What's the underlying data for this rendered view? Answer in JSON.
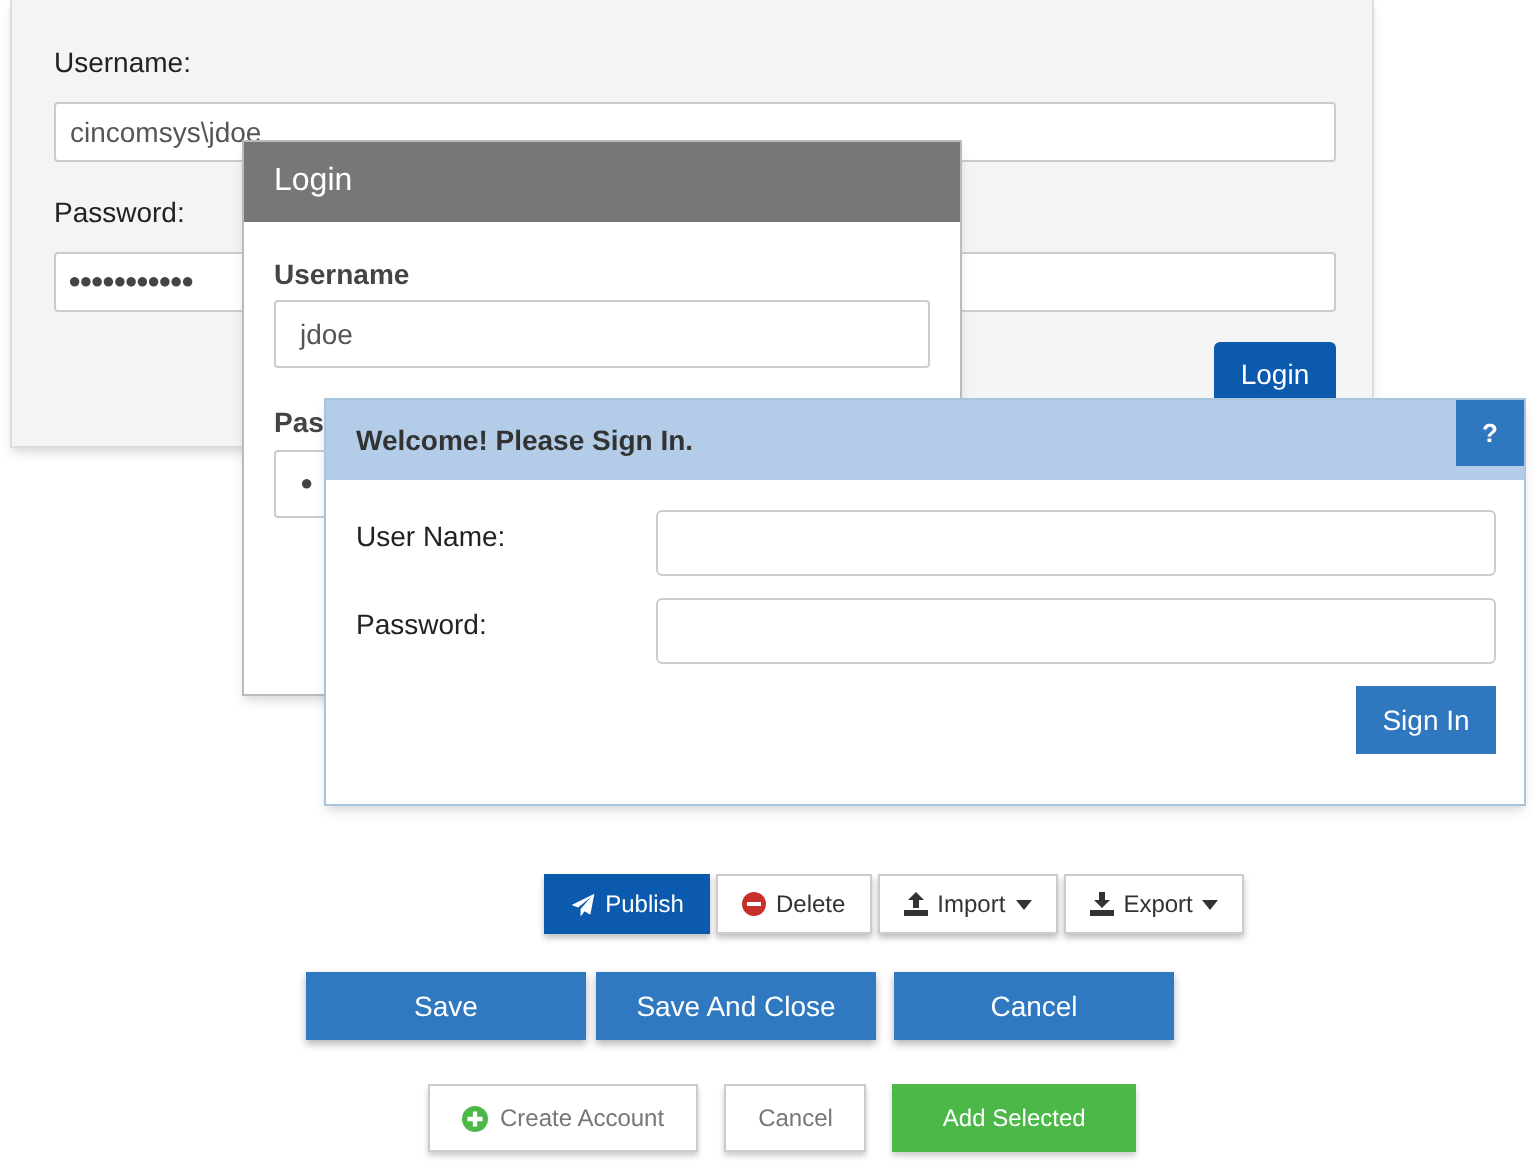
{
  "background_form": {
    "username_label": "Username:",
    "username_value": "cincomsys\\jdoe",
    "password_label": "Password:",
    "password_value": "●●●●●●●●●●●",
    "login_button": "Login"
  },
  "login_dialog": {
    "title": "Login",
    "username_label": "Username",
    "username_value": "jdoe",
    "password_label": "Pas",
    "password_value": "●"
  },
  "signin_dialog": {
    "title": "Welcome! Please Sign In.",
    "help_button": "?",
    "fields": [
      {
        "label": "User Name:"
      },
      {
        "label": "Password:"
      }
    ],
    "sign_in_button": "Sign In"
  },
  "toolbar": [
    {
      "label": "Publish",
      "kind": "primary",
      "dropdown": false
    },
    {
      "label": "Delete",
      "kind": "default",
      "dropdown": false
    },
    {
      "label": "Import",
      "kind": "default",
      "dropdown": true
    },
    {
      "label": "Export",
      "kind": "default",
      "dropdown": true
    }
  ],
  "action_buttons": [
    {
      "label": "Save"
    },
    {
      "label": "Save And Close"
    },
    {
      "label": "Cancel"
    }
  ],
  "bottom_buttons": [
    {
      "label": "Create Account",
      "kind": "outline"
    },
    {
      "label": "Cancel",
      "kind": "plain"
    },
    {
      "label": "Add Selected",
      "kind": "success"
    }
  ]
}
